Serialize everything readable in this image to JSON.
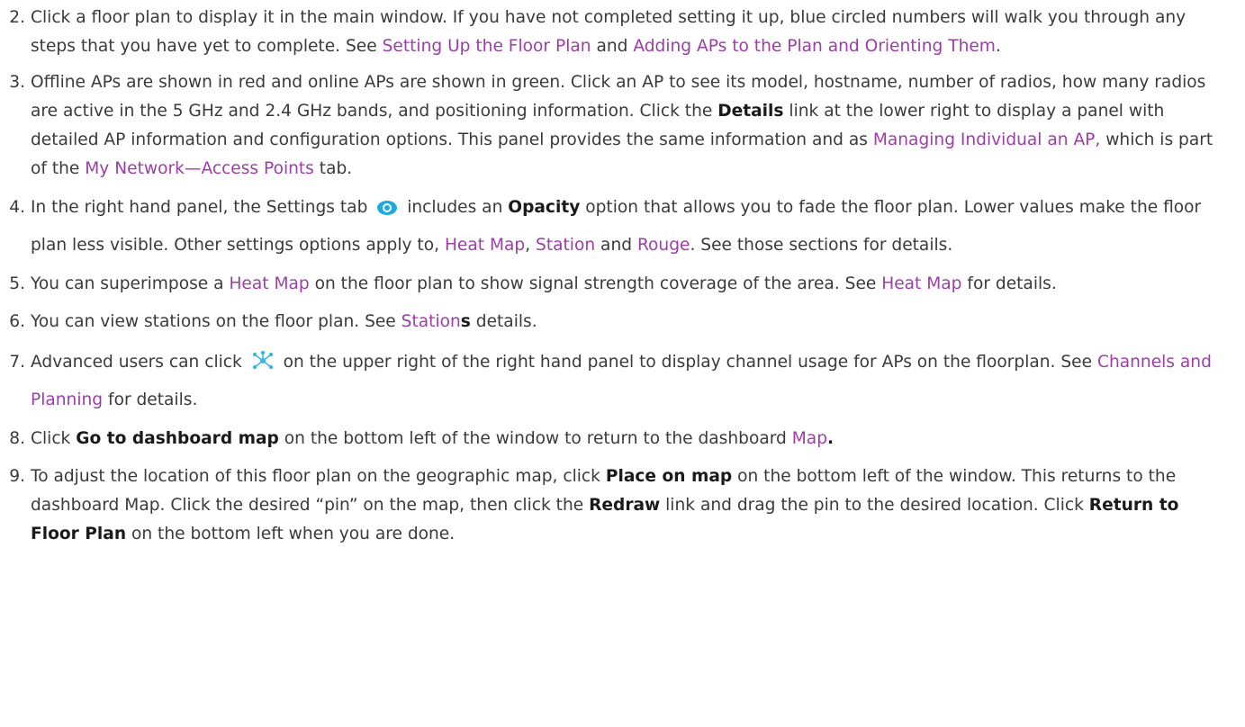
{
  "steps": [
    {
      "num": "2.",
      "segments": [
        {
          "t": "text",
          "v": "Click a floor plan to display it in the main window. If you have not completed setting it up, blue circled numbers will walk you through any steps that you have yet to complete. See "
        },
        {
          "t": "link",
          "v": "Setting Up the Floor Plan"
        },
        {
          "t": "text",
          "v": " and "
        },
        {
          "t": "link",
          "v": "Adding APs to the Plan and Orienting Them"
        },
        {
          "t": "text",
          "v": "."
        }
      ]
    },
    {
      "num": "3.",
      "segments": [
        {
          "t": "text",
          "v": "Offline APs are shown in red and online APs are shown in green. Click an AP to see its model, hostname, number of radios, how many radios are active in the 5 GHz and 2.4 GHz bands, and positioning information. Click the "
        },
        {
          "t": "bold",
          "v": "Details"
        },
        {
          "t": "text",
          "v": " link at the lower right to display a panel with detailed AP information and configuration options. This panel provides the same information and as "
        },
        {
          "t": "link",
          "v": "Managing Individual an AP,"
        },
        {
          "t": "text",
          "v": " which is part of the "
        },
        {
          "t": "link",
          "v": "My Network—Access Points"
        },
        {
          "t": "text",
          "v": " tab."
        }
      ]
    },
    {
      "num": "4.",
      "segments": [
        {
          "t": "text",
          "v": "In the right hand panel, the Settings tab "
        },
        {
          "t": "icon",
          "v": "eye-icon"
        },
        {
          "t": "text",
          "v": " includes an "
        },
        {
          "t": "bold",
          "v": "Opacity"
        },
        {
          "t": "text",
          "v": " option that allows you to fade the floor plan. Lower values make the floor plan less visible. Other settings options apply to, "
        },
        {
          "t": "link",
          "v": "Heat Map"
        },
        {
          "t": "text",
          "v": ", "
        },
        {
          "t": "link",
          "v": "Station"
        },
        {
          "t": "text",
          "v": " and "
        },
        {
          "t": "link",
          "v": "Rouge"
        },
        {
          "t": "text",
          "v": ". See those sections for details."
        }
      ]
    },
    {
      "num": "5.",
      "segments": [
        {
          "t": "text",
          "v": "You can superimpose a "
        },
        {
          "t": "link",
          "v": "Heat Map"
        },
        {
          "t": "text",
          "v": " on the floor plan to show signal strength coverage of the area. See "
        },
        {
          "t": "link",
          "v": "Heat Map"
        },
        {
          "t": "text",
          "v": " for details."
        }
      ]
    },
    {
      "num": "6.",
      "segments": [
        {
          "t": "text",
          "v": "You can view stations on the floor plan. See "
        },
        {
          "t": "link",
          "v": "Station"
        },
        {
          "t": "bold",
          "v": "s"
        },
        {
          "t": "text",
          "v": " details."
        }
      ]
    },
    {
      "num": "7.",
      "segments": [
        {
          "t": "text",
          "v": "Advanced users can click "
        },
        {
          "t": "icon",
          "v": "network-nodes-icon"
        },
        {
          "t": "text",
          "v": " on the upper right of the right hand panel to display channel usage for APs on the floorplan. See "
        },
        {
          "t": "link",
          "v": "Channels and Planning"
        },
        {
          "t": "text",
          "v": " for details."
        }
      ]
    },
    {
      "num": "8.",
      "segments": [
        {
          "t": "text",
          "v": "Click "
        },
        {
          "t": "bold",
          "v": "Go to dashboard map"
        },
        {
          "t": "text",
          "v": " on the bottom left of the window to return to the dashboard "
        },
        {
          "t": "link",
          "v": "Map"
        },
        {
          "t": "bold",
          "v": "."
        }
      ]
    },
    {
      "num": "9.",
      "segments": [
        {
          "t": "text",
          "v": "To adjust the location of this floor plan on the geographic map, click "
        },
        {
          "t": "bold",
          "v": "Place on map"
        },
        {
          "t": "text",
          "v": " on the bottom left of the window. This returns to the dashboard Map. Click the desired “pin” on the map, then click the "
        },
        {
          "t": "bold",
          "v": "Redraw"
        },
        {
          "t": "text",
          "v": " link and drag the pin to the desired location. Click "
        },
        {
          "t": "bold",
          "v": "Return to Floor Plan"
        },
        {
          "t": "text",
          "v": " on the bottom left when you are done."
        }
      ]
    }
  ],
  "colors": {
    "text": "#3a3a3a",
    "link": "#9b3ea6",
    "bold": "#1a1a1a",
    "eye_icon": "#1fa9e1",
    "nodes_icon": "#39b7e8"
  }
}
